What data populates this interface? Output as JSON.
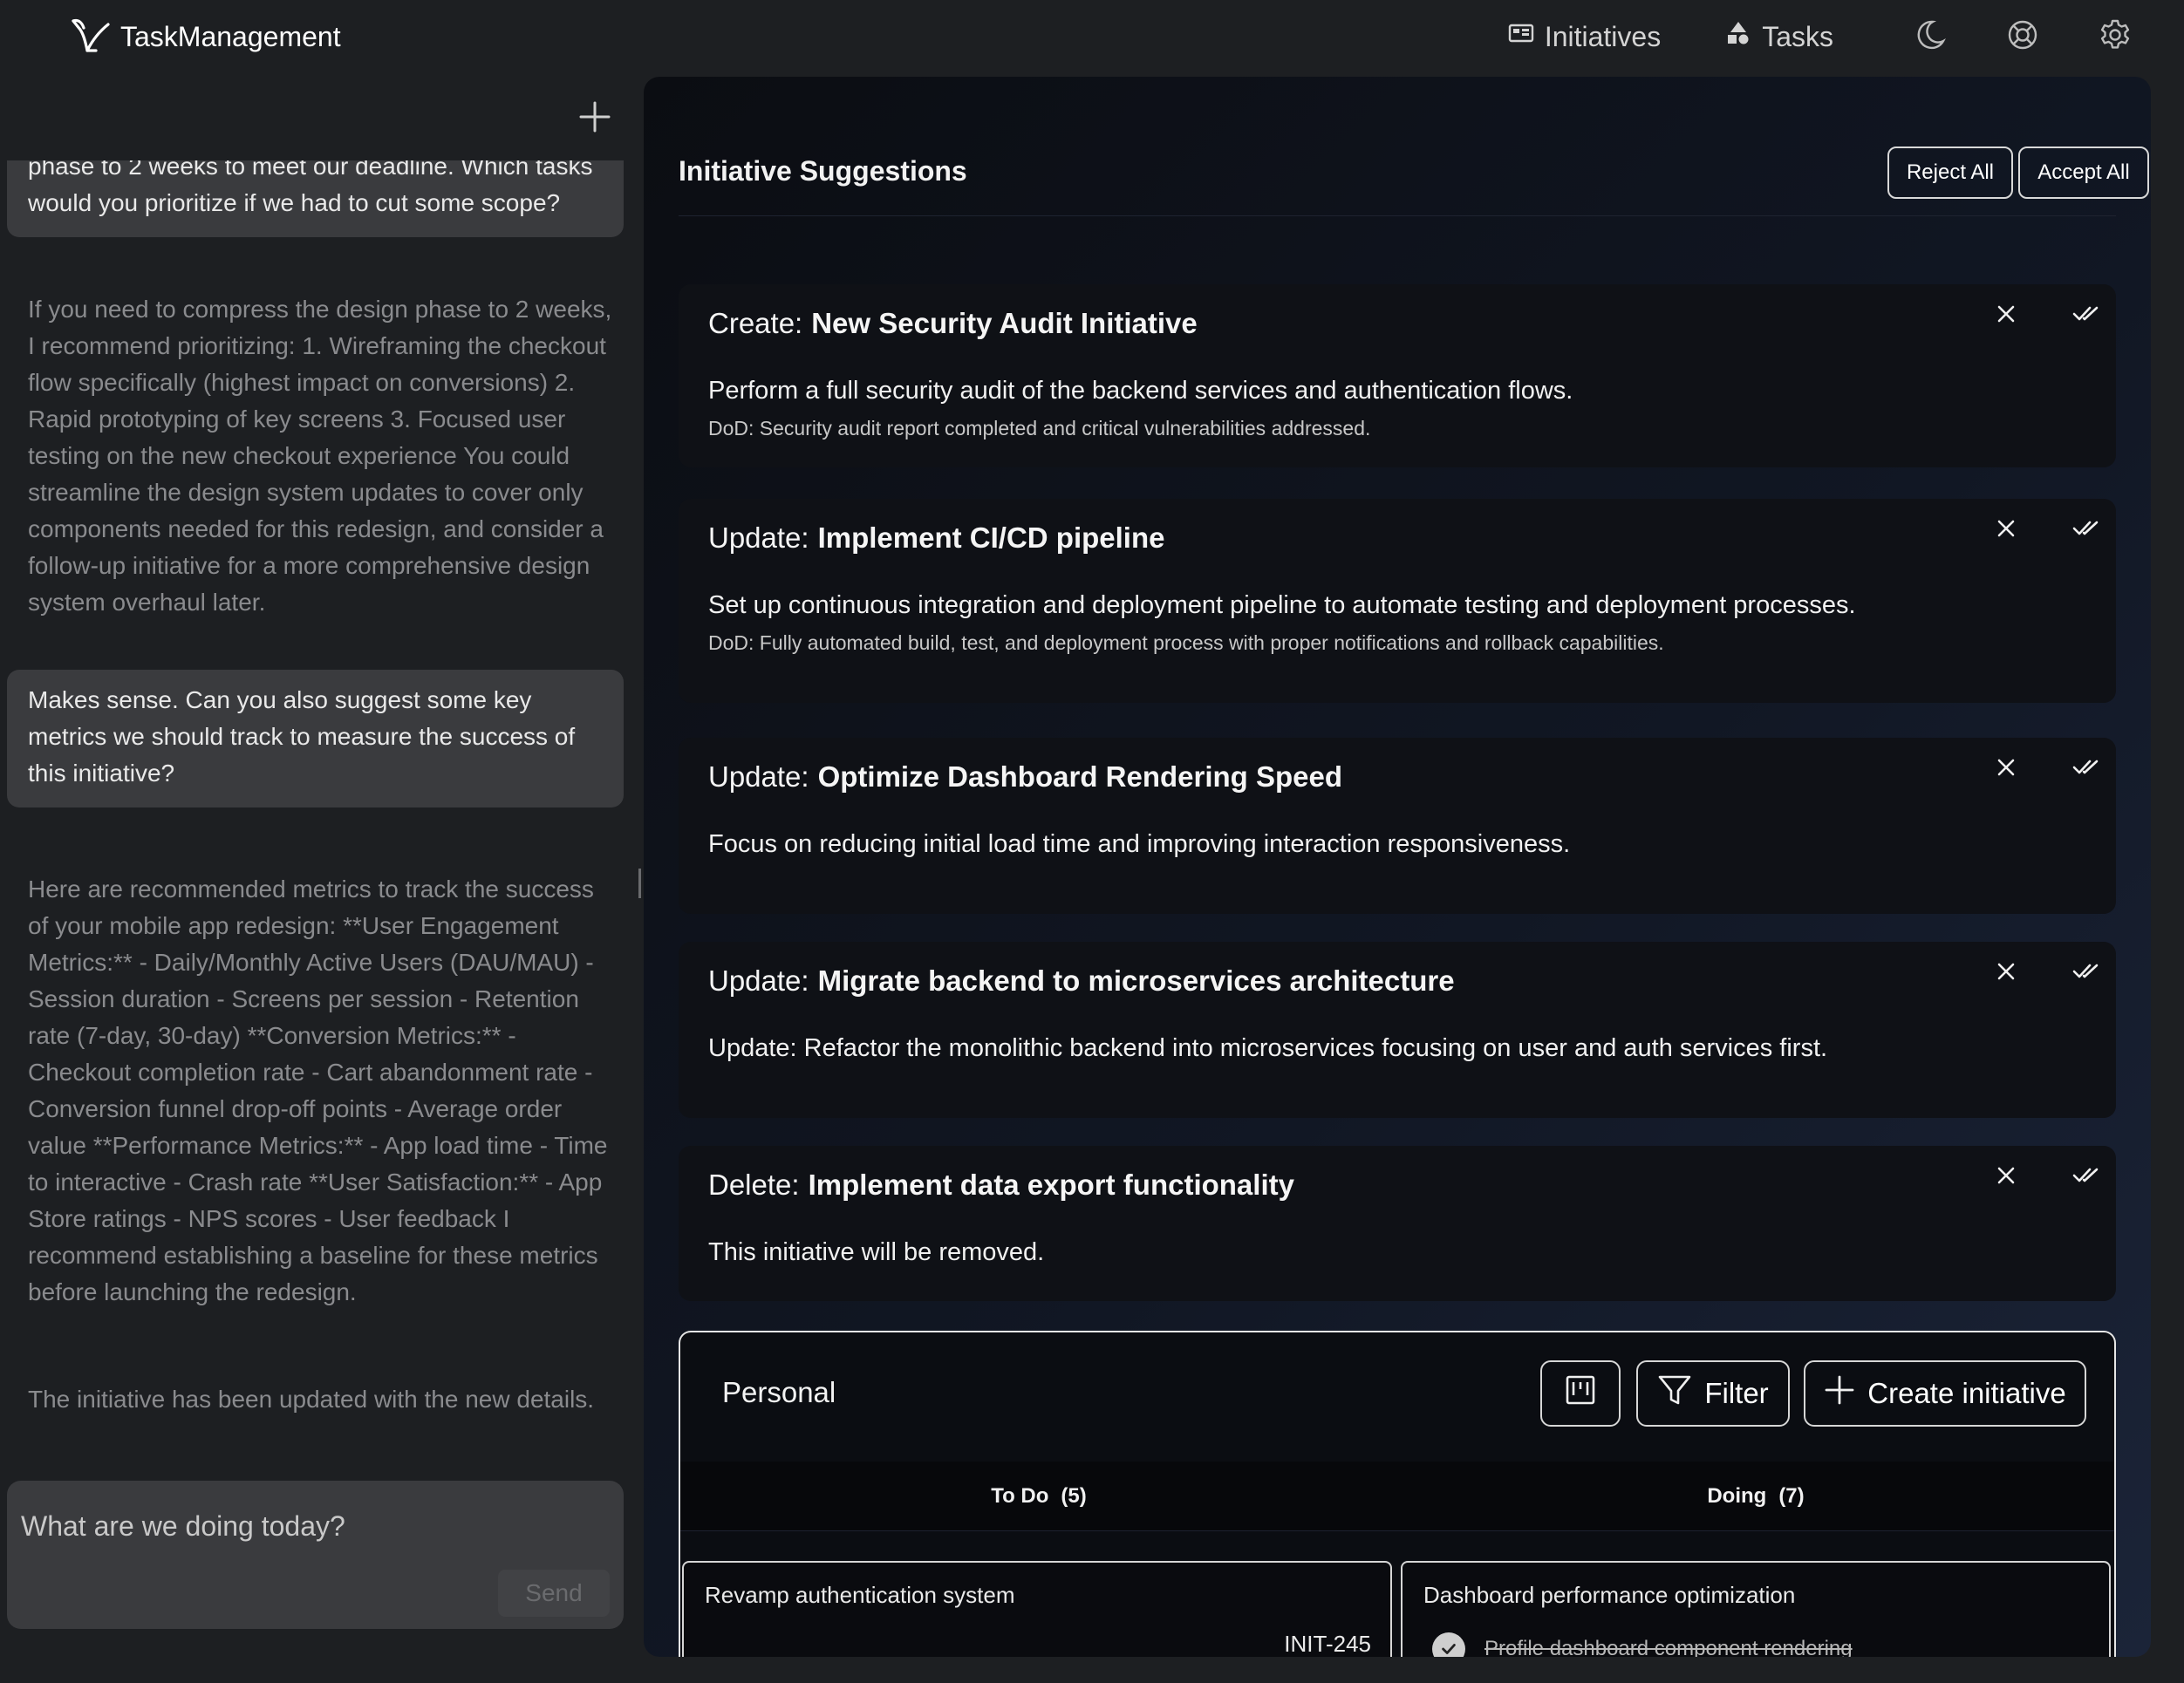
{
  "app": {
    "name": "TaskManagement"
  },
  "nav": {
    "initiatives": "Initiatives",
    "tasks": "Tasks"
  },
  "icons": {
    "logo": "check-logo-icon",
    "initiatives": "grid-icon",
    "tasks": "shapes-icon",
    "theme": "moon-icon",
    "help": "lifebuoy-icon",
    "settings": "gear-icon",
    "new_chat": "plus-icon",
    "reject": "close-icon",
    "accept": "double-check-icon",
    "kanban": "kanban-icon",
    "filter": "filter-icon",
    "create": "plus-icon",
    "done": "check-circle-icon"
  },
  "chat": {
    "messages": [
      {
        "role": "user",
        "text": "phase to 2 weeks to meet our deadline. Which tasks would you prioritize if we had to cut some scope?"
      },
      {
        "role": "assistant",
        "text": "If you need to compress the design phase to 2 weeks, I recommend prioritizing: 1. Wireframing the checkout flow specifically (highest impact on conversions) 2. Rapid prototyping of key screens 3. Focused user testing on the new checkout experience You could streamline the design system updates to cover only components needed for this redesign, and consider a follow-up initiative for a more comprehensive design system overhaul later."
      },
      {
        "role": "user",
        "text": "Makes sense. Can you also suggest some key metrics we should track to measure the success of this initiative?"
      },
      {
        "role": "assistant",
        "text": "Here are recommended metrics to track the success of your mobile app redesign: **User Engagement Metrics:** - Daily/Monthly Active Users (DAU/MAU) - Session duration - Screens per session - Retention rate (7-day, 30-day) **Conversion Metrics:** - Checkout completion rate - Cart abandonment rate - Conversion funnel drop-off points - Average order value **Performance Metrics:** - App load time - Time to interactive - Crash rate **User Satisfaction:** - App Store ratings - NPS scores - User feedback I recommend establishing a baseline for these metrics before launching the redesign."
      },
      {
        "role": "assistant",
        "text": "The initiative has been updated with the new details."
      }
    ],
    "input_placeholder": "What are we doing today?",
    "send_label": "Send"
  },
  "suggestions": {
    "title": "Initiative Suggestions",
    "reject_all": "Reject All",
    "accept_all": "Accept All",
    "items": [
      {
        "action": "Create:",
        "name": "New Security Audit Initiative",
        "description": "Perform a full security audit of the backend services and authentication flows.",
        "dod": "DoD: Security audit report completed and critical vulnerabilities addressed."
      },
      {
        "action": "Update:",
        "name": "Implement CI/CD pipeline",
        "description": "Set up continuous integration and deployment pipeline to automate testing and deployment processes.",
        "dod": "DoD: Fully automated build, test, and deployment process with proper notifications and rollback capabilities."
      },
      {
        "action": "Update:",
        "name": "Optimize Dashboard Rendering Speed",
        "description": "Focus on reducing initial load time and improving interaction responsiveness.",
        "dod": ""
      },
      {
        "action": "Update:",
        "name": "Migrate backend to microservices architecture",
        "description": "Update: Refactor the monolithic backend into microservices focusing on user and auth services first.",
        "dod": ""
      },
      {
        "action": "Delete:",
        "name": "Implement data export functionality",
        "description": "This initiative will be removed.",
        "dod": ""
      }
    ]
  },
  "board": {
    "name": "Personal",
    "filter_label": "Filter",
    "create_label": "Create initiative",
    "columns": [
      {
        "title": "To Do",
        "count": "(5)"
      },
      {
        "title": "Doing",
        "count": "(7)"
      }
    ],
    "cards": [
      {
        "title": "Revamp authentication system",
        "id": "INIT-245"
      },
      {
        "title": "Dashboard performance optimization",
        "subtask": "Profile dashboard component rendering"
      }
    ]
  }
}
